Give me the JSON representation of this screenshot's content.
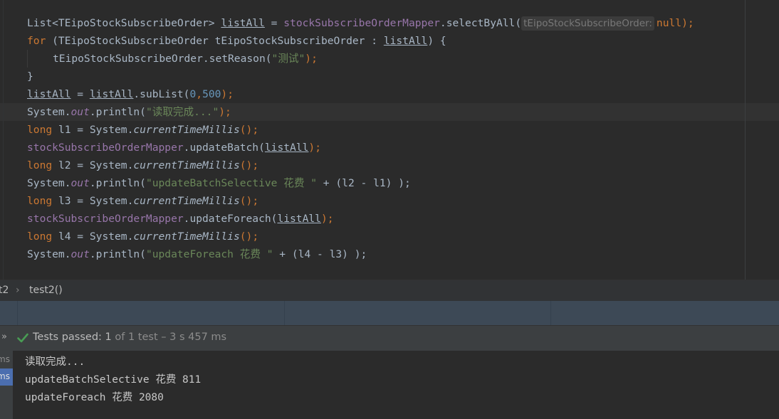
{
  "editor": {
    "line1": {
      "type": "List<TEipoStockSubscribeOrder> ",
      "var": "listAll",
      "eq": " = ",
      "mapper": "stockSubscribeOrderMapper",
      "call": ".selectByAll(",
      "hint": "tEipoStockSubscribeOrder:",
      "nullkw": "null",
      "end": ");"
    },
    "line2": {
      "kw": "for",
      "rest": " (TEipoStockSubscribeOrder tEipoStockSubscribeOrder : ",
      "var": "listAll",
      "end": ") {"
    },
    "line3": {
      "call": "tEipoStockSubscribeOrder.setReason(",
      "str": "\"测试\"",
      "end": ");"
    },
    "line4": {
      "text": "}"
    },
    "line5": {
      "var1": "listAll",
      "eq": " = ",
      "var2": "listAll",
      "call": ".subList(",
      "n1": "0",
      "comma": ",",
      "n2": "500",
      "end": ");"
    },
    "line6": {
      "pre": "System.",
      "field": "out",
      "call": ".println(",
      "str": "\"读取完成...\"",
      "end": ");"
    },
    "line7": {
      "kw": "long",
      "mid": " l1 = System.",
      "static": "currentTimeMillis",
      "end": "();"
    },
    "line8": {
      "mapper": "stockSubscribeOrderMapper",
      "call": ".updateBatch(",
      "var": "listAll",
      "end": ");"
    },
    "line9": {
      "kw": "long",
      "mid": " l2 = System.",
      "static": "currentTimeMillis",
      "end": "();"
    },
    "line10": {
      "pre": "System.",
      "field": "out",
      "call": ".println(",
      "str": "\"updateBatchSelective 花费 \"",
      "end": " + (l2 - l1) );"
    },
    "line11": {
      "kw": "long",
      "mid": " l3 = System.",
      "static": "currentTimeMillis",
      "end": "();"
    },
    "line12": {
      "mapper": "stockSubscribeOrderMapper",
      "call": ".updateForeach(",
      "var": "listAll",
      "end": ");"
    },
    "line13": {
      "kw": "long",
      "mid": " l4 = System.",
      "static": "currentTimeMillis",
      "end": "();"
    },
    "line14": {
      "pre": "System.",
      "field": "out",
      "call": ".println(",
      "str": "\"updateForeach 花费 \"",
      "end": " + (l4 - l3) );"
    }
  },
  "breadcrumb": {
    "class_fragment": "t2",
    "separator": "›",
    "method": "test2()"
  },
  "status": {
    "arrows": "»",
    "check_icon": "check-icon",
    "label": "Tests passed: ",
    "passed": "1",
    "rest": " of 1 test – 3 s 457 ms"
  },
  "console_left": {
    "top": "ms",
    "selected": "ms"
  },
  "console": {
    "lines": [
      "读取完成...",
      "updateBatchSelective 花费 811",
      "updateForeach 花费 2080"
    ]
  },
  "colors": {
    "keyword": "#cc7832",
    "string": "#6a8759",
    "field": "#9876aa",
    "number": "#6897bb",
    "pass_green": "#499c54",
    "selection": "#4b6eaf"
  }
}
